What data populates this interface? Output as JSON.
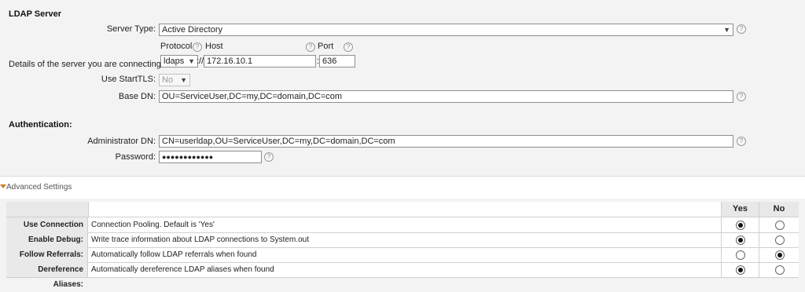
{
  "ldap": {
    "title": "LDAP Server",
    "server_type_label": "Server Type:",
    "server_type_value": "Active Directory",
    "protocol_label": "Protocol",
    "host_label": "Host",
    "port_label": "Port",
    "details_label": "Details of the server you are connecting to:",
    "protocol_value": "ldaps",
    "separator_slashes": "://",
    "host_value": "172.16.10.1",
    "port_separator": ":",
    "port_value": "636",
    "starttls_label": "Use StartTLS:",
    "starttls_value": "No",
    "base_dn_label": "Base DN:",
    "base_dn_value": "OU=ServiceUser,DC=my,DC=domain,DC=com",
    "help_glyph": "?"
  },
  "auth": {
    "title": "Authentication:",
    "admin_dn_label": "Administrator DN:",
    "admin_dn_value": "CN=userldap,OU=ServiceUser,DC=my,DC=domain,DC=com",
    "password_label": "Password:",
    "password_value": "●●●●●●●●●●●●"
  },
  "advanced": {
    "title": "Advanced Settings",
    "yes_header": "Yes",
    "no_header": "No",
    "rows": [
      {
        "label": "Use Connection Pool:",
        "desc": "Connection Pooling. Default is 'Yes'",
        "selected": "yes"
      },
      {
        "label": "Enable Debug:",
        "desc": "Write trace information about LDAP connections to System.out",
        "selected": "yes"
      },
      {
        "label": "Follow Referrals:",
        "desc": "Automatically follow LDAP referrals when found",
        "selected": "no"
      },
      {
        "label": "Dereference Aliases:",
        "desc": "Automatically dereference LDAP aliases when found",
        "selected": "yes"
      }
    ]
  }
}
